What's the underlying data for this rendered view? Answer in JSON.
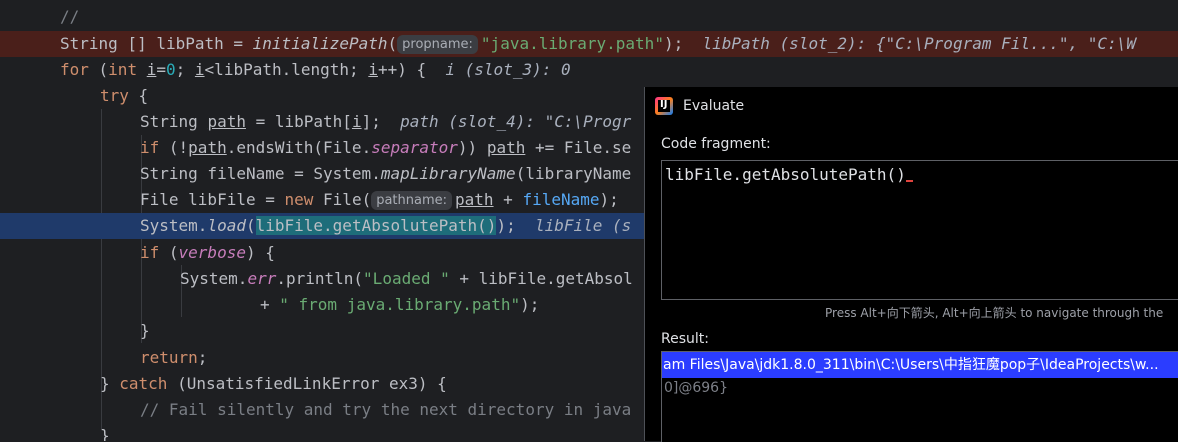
{
  "editor": {
    "l1": "//",
    "l2": {
      "t1": "String [] libPath = ",
      "call": "initializePath",
      "paren": "(",
      "hint": "propname:",
      "str": "\"java.library.path\"",
      "end": ");",
      "inline": "  libPath (slot_2): {\"C:\\Program Fil...\", \"C:\\W"
    },
    "l3": {
      "kw": "for",
      "t1": " (",
      "kw2": "int",
      "sp": " ",
      "i": "i",
      "t2": "=",
      "zero": "0",
      "t3": "; ",
      "i2": "i",
      "t4": "<libPath.length; ",
      "i3": "i",
      "t5": "++) {",
      "inline": "  i (slot_3): 0"
    },
    "l4": {
      "kw": "try",
      "t1": " {"
    },
    "l5": {
      "t1": "String ",
      "path": "path",
      "t2": " = libPath[",
      "i": "i",
      "t3": "];",
      "inline": "  path (slot_4): \"C:\\Progr"
    },
    "l6": {
      "kw": "if",
      "t1": " (!",
      "path": "path",
      "t2": ".endsWith(File.",
      "sep": "separator",
      "t3": ")) ",
      "path2": "path",
      "t4": " += File.se"
    },
    "l7": {
      "t1": "String fileName = System.",
      "call": "mapLibraryName",
      "t2": "(libraryName"
    },
    "l8": {
      "t1": "File libFile = ",
      "kw": "new",
      "t2": " File(",
      "hint": "pathname:",
      "path": "path",
      "t3": " + ",
      "fn": "fileName",
      "t4": ");"
    },
    "l9": {
      "t1": "System.",
      "call": "load",
      "paren": "(",
      "sel": "libFile.getAbsolutePath()",
      "end": ");",
      "inline": "  libFile (s"
    },
    "l10": {
      "kw": "if",
      "t1": " (",
      "verbose": "verbose",
      "t2": ") {"
    },
    "l11": {
      "t1": "System.",
      "err": "err",
      "t2": ".println(",
      "str": "\"Loaded \"",
      "t3": " + libFile.getAbsol"
    },
    "l12": {
      "t1": "+ ",
      "str": "\" from java.library.path\"",
      "t2": ");"
    },
    "l13": "}",
    "l14": {
      "kw": "return",
      "t1": ";"
    },
    "l15": {
      "t1": "} ",
      "kw": "catch",
      "t2": " (UnsatisfiedLinkError ex3) {"
    },
    "l16": "// Fail silently and try the next directory in java",
    "l17": "}"
  },
  "evaluate": {
    "title": "Evaluate",
    "logo_letter": "IJ",
    "code_label": "Code fragment:",
    "fragment": "libFile.getAbsolutePath()",
    "nav_hint": "Press Alt+向下箭头, Alt+向上箭头 to navigate through the",
    "result_label": "Result:",
    "result_value": "am Files\\Java\\jdk1.8.0_311\\bin\\C:\\Users\\中指狂魔pop子\\IdeaProjects\\w...",
    "result_ref": "0]@696}"
  }
}
